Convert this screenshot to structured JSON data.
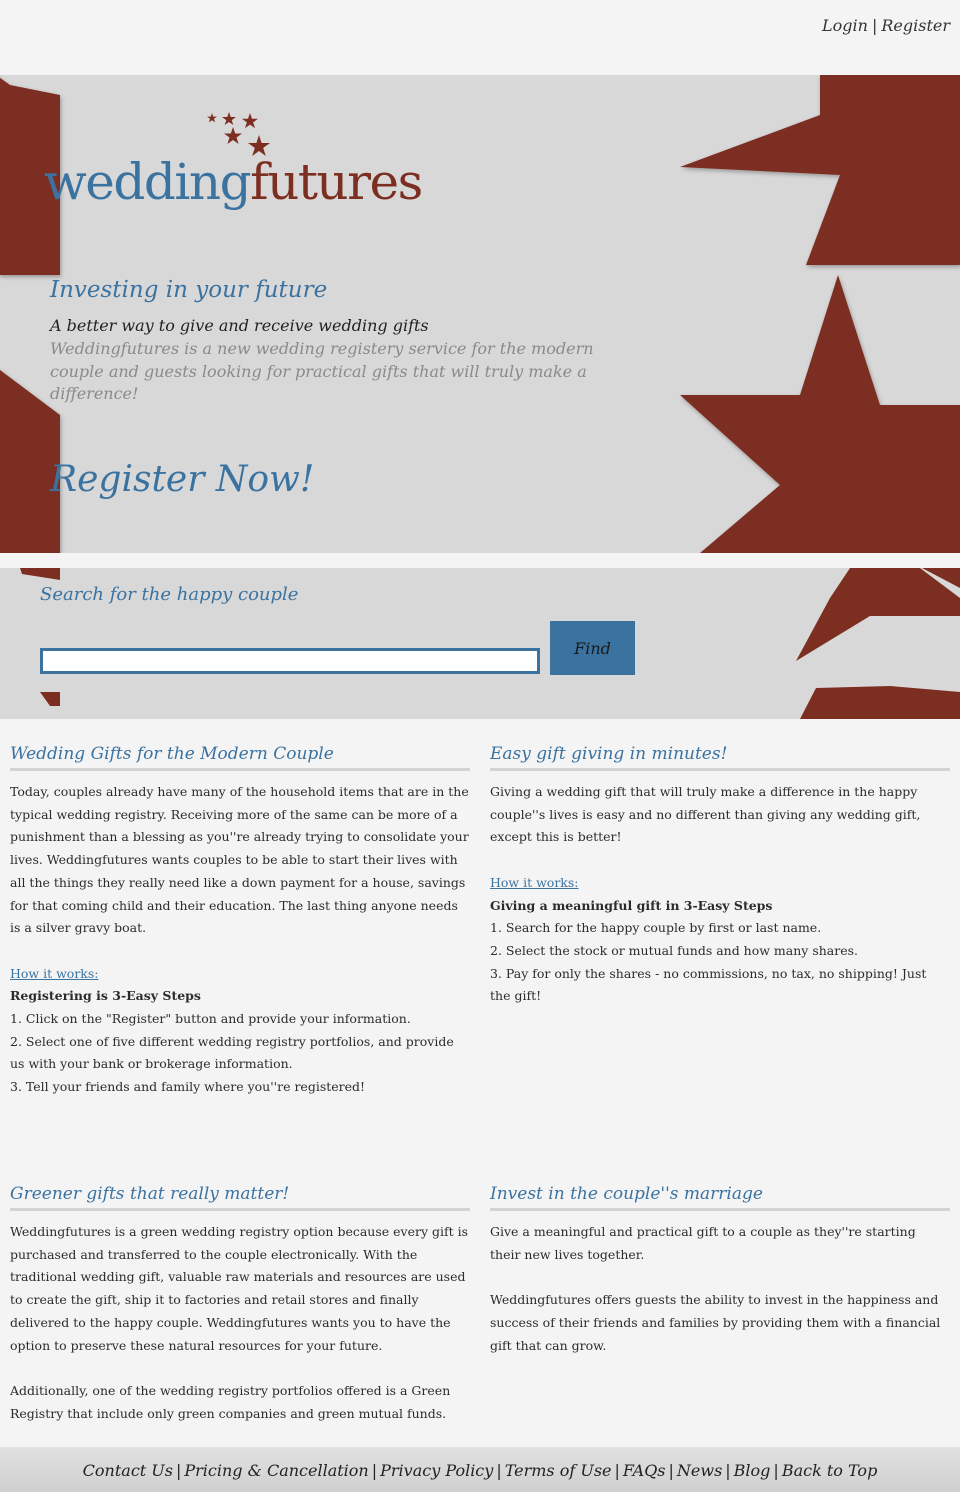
{
  "header": {
    "login_label": "Login",
    "separator": "|",
    "register_label": "Register"
  },
  "hero": {
    "logo": {
      "part1": "wedding",
      "part2": "futures"
    },
    "tagline": "Investing in your future",
    "subtagline": "A better way to give and receive wedding gifts",
    "description": "Weddingfutures is a new wedding registery service for the modern couple and guests looking for practical gifts that will truly make a difference!",
    "cta_label": "Register Now!"
  },
  "search": {
    "title": "Search for the happy couple",
    "input_value": "",
    "button_label": "Find"
  },
  "sections": {
    "modern_couple": {
      "title": "Wedding Gifts for the Modern Couple",
      "body": "Today, couples already have many of the household items that are in the typical wedding registry. Receiving more of the same can be more of a punishment than a blessing as you''re already trying to consolidate your lives. Weddingfutures wants couples to be able to start their lives with all the things they really need like a down payment for a house, savings for that coming child and their education. The last thing anyone needs is a silver gravy boat.",
      "how_label": "How it works:",
      "steps_title": "Registering is 3-Easy Steps",
      "steps": [
        "1. Click on the \"Register\" button and provide your information.",
        "2. Select one of five different wedding registry portfolios, and provide us with your bank or brokerage information.",
        "3. Tell your friends and family where you''re registered!"
      ]
    },
    "easy_giving": {
      "title": "Easy gift giving in minutes!",
      "body": "Giving a wedding gift that will truly make a difference in the happy couple''s lives is easy and no different than giving any wedding gift, except this is better!",
      "how_label": "How it works:",
      "steps_title": "Giving a meaningful gift in 3-Easy Steps",
      "steps": [
        "1. Search for the happy couple by first or last name.",
        "2. Select the stock or mutual funds and how many shares.",
        "3. Pay for only the shares - no commissions, no tax, no shipping! Just the gift!"
      ]
    },
    "greener": {
      "title": "Greener gifts that really matter!",
      "body1": "Weddingfutures is a green wedding registry option because every gift is purchased and transferred to the couple electronically. With the traditional wedding gift, valuable raw materials and resources are used to create the gift, ship it to factories and retail stores and finally delivered to the happy couple. Weddingfutures wants you to have the option to preserve these natural resources for your future.",
      "body2": "Additionally, one of the wedding registry portfolios offered is a Green Registry that include only green companies and green mutual funds."
    },
    "invest": {
      "title": "Invest in the couple''s marriage",
      "body1": "Give a meaningful and practical gift to a couple as they''re starting their new lives together.",
      "body2": "Weddingfutures offers guests the ability to invest in the happiness and success of their friends and families by providing them with a financial gift that can grow."
    }
  },
  "footer": {
    "separator": "|",
    "links": [
      "Contact Us",
      "Pricing & Cancellation",
      "Privacy Policy",
      "Terms of Use",
      "FAQs",
      "News",
      "Blog",
      "Back to Top"
    ]
  },
  "colors": {
    "star_red": "#7c2f21",
    "brand_blue": "#3a72a0",
    "hero_gray": "#d9d8d9",
    "page_bg": "#f5f4f5"
  },
  "icons": [
    "star-icon"
  ]
}
